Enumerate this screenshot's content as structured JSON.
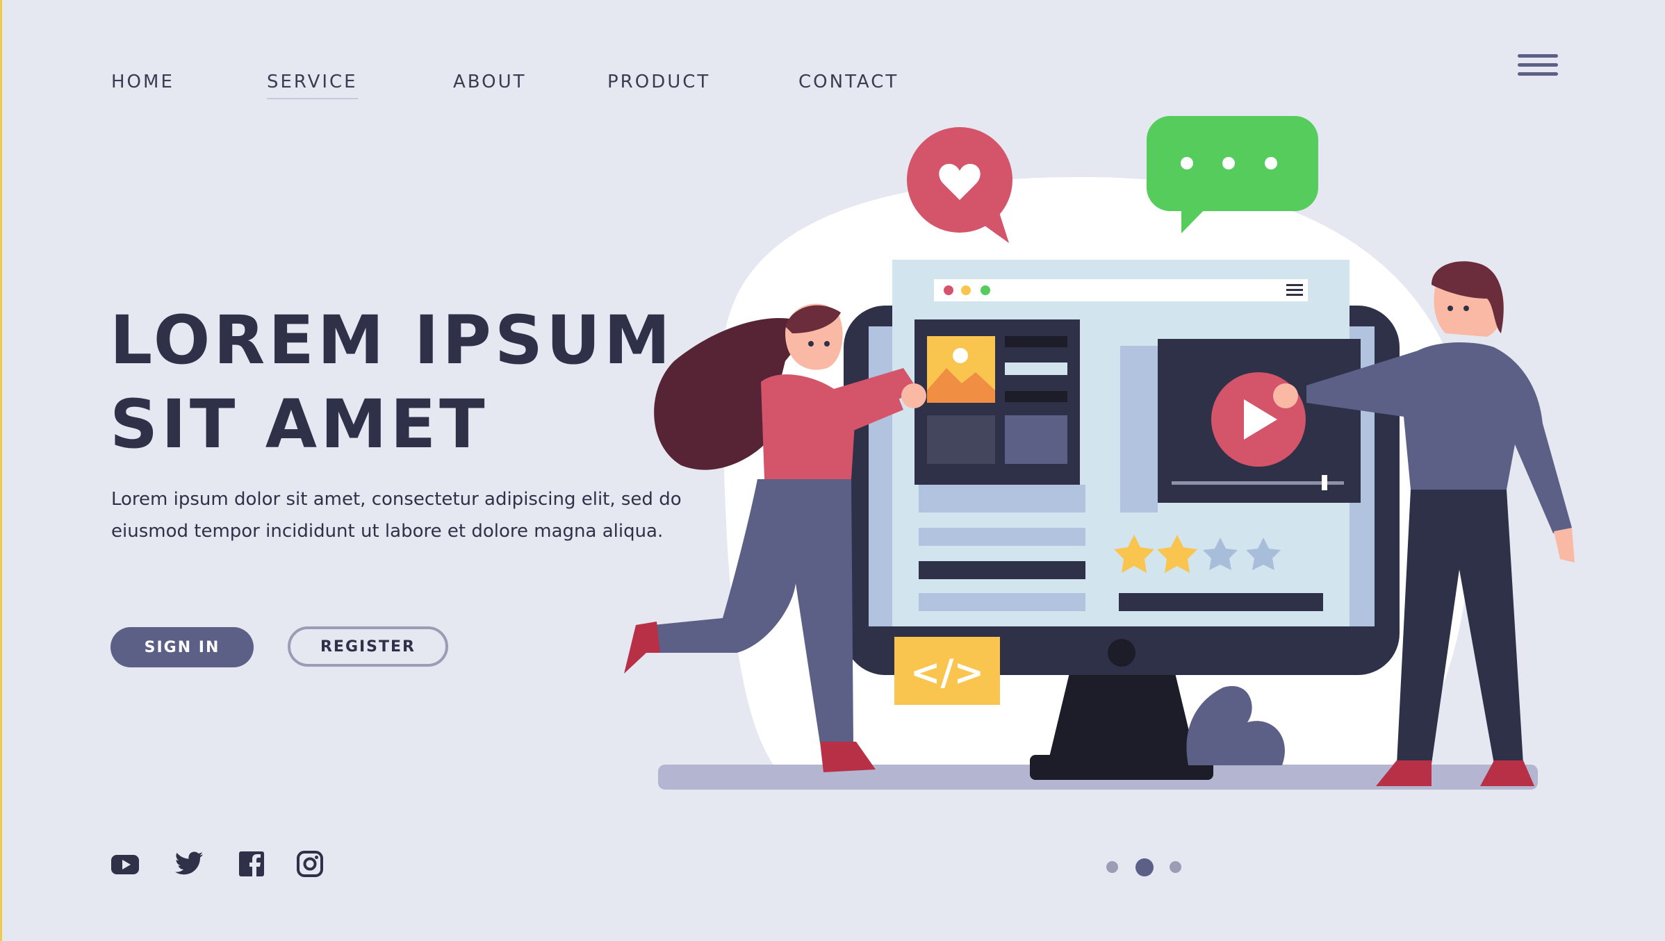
{
  "nav": {
    "items": [
      {
        "label": "HOME",
        "active": false
      },
      {
        "label": "SERVICE",
        "active": true
      },
      {
        "label": "ABOUT",
        "active": false
      },
      {
        "label": "PRODUCT",
        "active": false
      },
      {
        "label": "CONTACT",
        "active": false
      }
    ],
    "menu_icon": "hamburger-menu-icon"
  },
  "hero": {
    "title_line1": "LOREM IPSUM",
    "title_line2": "SIT AMET",
    "description": "Lorem ipsum dolor sit amet, consectetur adipiscing elit, sed do eiusmod tempor incididunt ut labore et dolore magna aliqua.",
    "primary_button": "SIGN IN",
    "secondary_button": "REGISTER"
  },
  "social": [
    "youtube-icon",
    "twitter-icon",
    "facebook-icon",
    "instagram-icon"
  ],
  "pagination": {
    "pages": 3,
    "current": 2
  },
  "illustration": {
    "rating": {
      "value": 2,
      "max": 4
    },
    "code_badge": "</>"
  },
  "colors": {
    "background": "#e6e8f1",
    "text_dark": "#2f3148",
    "accent_purple": "#5c5f86",
    "accent_pink": "#d4546a",
    "accent_green": "#55cc5c",
    "accent_yellow": "#f9c54e"
  }
}
